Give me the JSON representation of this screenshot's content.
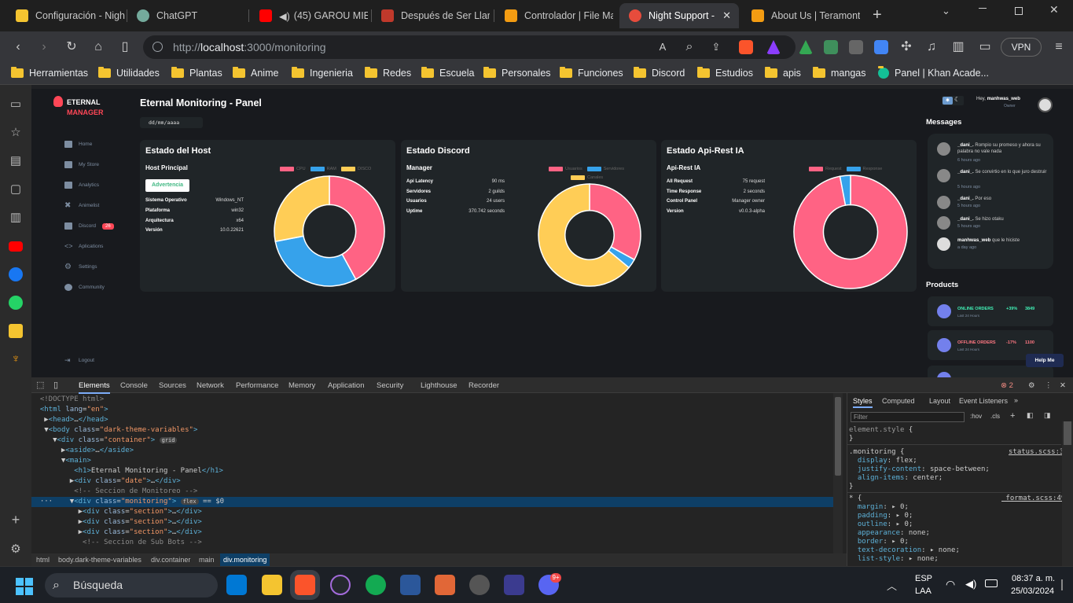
{
  "browser": {
    "tabs": [
      {
        "title": "Configuración - Nigh",
        "fav": "#f4c430"
      },
      {
        "title": "ChatGPT",
        "fav": "#74aa9c"
      },
      {
        "title": "(45) GAROU MIE",
        "fav": "#ff0000"
      },
      {
        "title": "Después de Ser Llam",
        "fav": "#c0392b"
      },
      {
        "title": "Controlador | File Ma",
        "fav": "#f39c12"
      },
      {
        "title": "Night Support -",
        "fav": "#e74c3c"
      },
      {
        "title": "About Us | Teramont",
        "fav": "#f39c12"
      }
    ],
    "new_tab": "+",
    "url_prefix": "http://",
    "url_host": "localhost",
    "url_rest": ":3000/monitoring",
    "vpn": "VPN",
    "bookmarks": [
      "Herramientas",
      "Utilidades",
      "Plantas",
      "Anime",
      "Ingenieria",
      "Redes",
      "Escuela",
      "Personales",
      "Funciones",
      "Discord",
      "Estudios",
      "apis",
      "mangas",
      "Panel | Khan Acade..."
    ]
  },
  "app": {
    "logo_top": "ETERNAL",
    "logo_bottom": "MANAGER",
    "title": "Eternal Monitoring - Panel",
    "date": "dd/mm/aaaa",
    "menu": [
      "Home",
      "My Store",
      "Analytics",
      "Animelist",
      "Discord",
      "Aplications",
      "Settings",
      "Community"
    ],
    "discord_badge": "26",
    "logout": "Logout",
    "greeting": "Hey,",
    "user": "manhwas_web",
    "role": "Owner",
    "cards": [
      {
        "title": "Estado del Host",
        "subtitle": "Host Principal",
        "button": "Advertencia",
        "rows": [
          [
            "Sistema Operativo",
            "Windows_NT"
          ],
          [
            "Plataforma",
            "win32"
          ],
          [
            "Arquitectura",
            "x64"
          ],
          [
            "Versión",
            "10.0.22621"
          ]
        ],
        "legend": [
          "CPU",
          "RAM",
          "DISCO"
        ]
      },
      {
        "title": "Estado Discord",
        "subtitle": "Manager",
        "rows": [
          [
            "Api Latency",
            "90 ms"
          ],
          [
            "Servidores",
            "2 guilds"
          ],
          [
            "Usuarios",
            "24 users"
          ],
          [
            "Uptime",
            "370.742 seconds"
          ]
        ],
        "legend": [
          "Usuarios",
          "Servidores",
          "Canales"
        ]
      },
      {
        "title": "Estado Api-Rest IA",
        "subtitle": "Api-Rest IA",
        "rows": [
          [
            "All Request",
            "75 request"
          ],
          [
            "Time Response",
            "2 seconds"
          ],
          [
            "Control Panel",
            "Manager owner"
          ],
          [
            "Version",
            "v0.0.3-alpha"
          ]
        ],
        "legend": [
          "Request",
          "Response"
        ]
      }
    ],
    "messages_title": "Messages",
    "messages": [
      {
        "user": "_dani_.",
        "text": "Rompio su promeso y ahora su palabra no vale nada",
        "ago": "6 hours ago"
      },
      {
        "user": "_dani_.",
        "text": "Se convirtio en lo que juro destruir",
        "ago": "5 hours ago"
      },
      {
        "user": "_dani_.",
        "text": "Por eso",
        "ago": "5 hours ago"
      },
      {
        "user": "_dani_.",
        "text": "Se hizo otaku",
        "ago": "5 hours ago"
      },
      {
        "user": "manhwas_web",
        "text": "que le hiciste",
        "ago": "a day ago"
      }
    ],
    "products_title": "Products",
    "products": [
      {
        "name": "ONLINE ORDERS",
        "last": "Last 24 Hours",
        "pct": "+39%",
        "count": "3849"
      },
      {
        "name": "OFFLINE ORDERS",
        "last": "Last 24 Hours",
        "pct": "-17%",
        "count": "1100"
      }
    ],
    "help": "Help Me"
  },
  "chart_data": [
    {
      "type": "pie",
      "labels": [
        "CPU",
        "RAM",
        "DISCO"
      ],
      "values": [
        42,
        30,
        28
      ],
      "colors": [
        "#ff6384",
        "#36a2eb",
        "#ffcd56"
      ]
    },
    {
      "type": "pie",
      "labels": [
        "Usuarios",
        "Servidores",
        "Canales"
      ],
      "values": [
        33,
        3,
        64
      ],
      "colors": [
        "#ff6384",
        "#36a2eb",
        "#ffcd56"
      ]
    },
    {
      "type": "pie",
      "labels": [
        "Request",
        "Response"
      ],
      "values": [
        97,
        3
      ],
      "colors": [
        "#ff6384",
        "#36a2eb"
      ]
    }
  ],
  "devtools": {
    "tabs": [
      "Elements",
      "Console",
      "Sources",
      "Network",
      "Performance",
      "Memory",
      "Application",
      "Security",
      "Lighthouse",
      "Recorder"
    ],
    "issues": "2",
    "style_tabs": [
      "Styles",
      "Computed",
      "Layout",
      "Event Listeners"
    ],
    "filter": "Filter",
    "hov": ":hov",
    "cls": ".cls",
    "crumbs": [
      "html",
      "body.dark-theme-variables",
      "div.container",
      "main",
      "div.monitoring"
    ]
  },
  "taskbar": {
    "search": "Búsqueda",
    "lang1": "ESP",
    "lang2": "LAA",
    "time": "08:37 a. m.",
    "date": "25/03/2024",
    "discord_badge": "9+"
  }
}
